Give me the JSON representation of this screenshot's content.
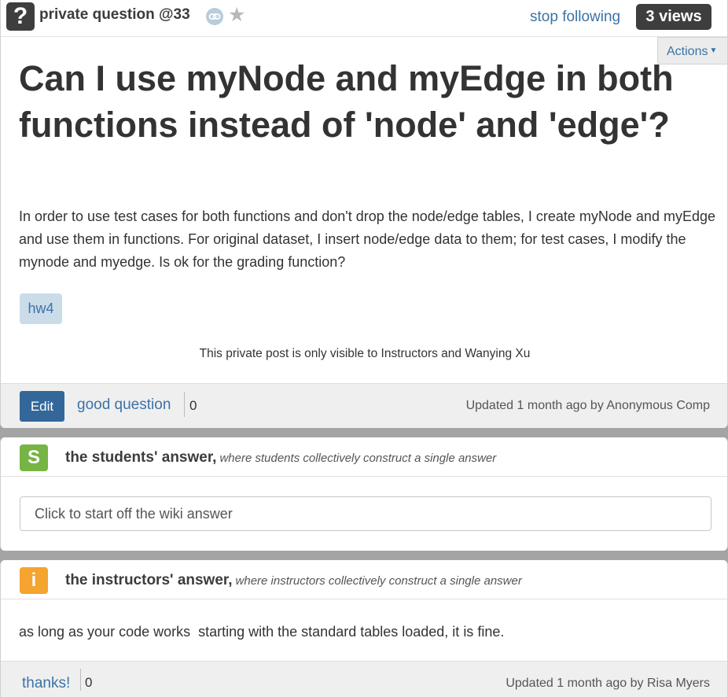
{
  "header": {
    "icon": "question-mark-icon",
    "type_label": "private question @33",
    "stop_following": "stop following",
    "views": "3 views",
    "actions": "Actions"
  },
  "question": {
    "title": "Can I use myNode and myEdge in both functions instead of 'node' and 'edge'?",
    "body": "In order to use test cases for both functions and don't drop the node/edge tables, I create myNode and myEdge and use them in functions. For original dataset, I insert node/edge data to them; for test cases, I modify the mynode and myedge. Is ok for the grading function?",
    "tag": "hw4",
    "private_note": "This private post is only visible to Instructors and Wanying Xu",
    "edit_label": "Edit",
    "good_question": "good question",
    "good_count": "0",
    "updated": "Updated 1 month ago by Anonymous Comp"
  },
  "students_answer": {
    "badge": "S",
    "title": "the students' answer,",
    "subtitle": "where students collectively construct a single answer",
    "placeholder": "Click to start off the wiki answer"
  },
  "instructors_answer": {
    "badge": "i",
    "title": "the instructors' answer,",
    "subtitle": "where instructors collectively construct a single answer",
    "text": "as long as your code works  starting with the standard tables loaded, it is fine.",
    "thanks": "thanks!",
    "thanks_count": "0",
    "updated": "Updated 1 month ago by Risa Myers"
  },
  "colors": {
    "link": "#3b73a6",
    "edit_button": "#33679a",
    "students_badge": "#76b443",
    "instructors_badge": "#f4a42f"
  }
}
